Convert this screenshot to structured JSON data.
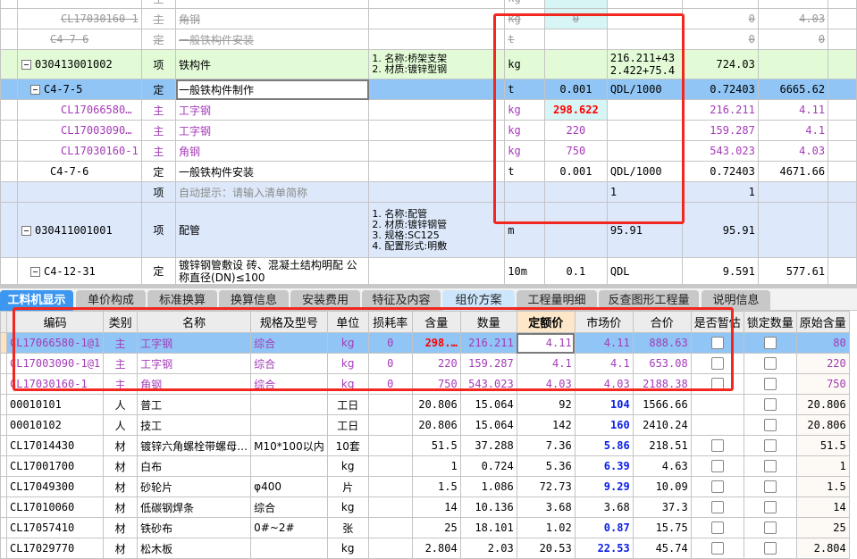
{
  "top_grid": {
    "rows": [
      {
        "style": "strike",
        "level": 2,
        "code": "",
        "type": "主",
        "name": "",
        "feature": "",
        "unit": "kg",
        "content": "",
        "expr": "",
        "qty": "",
        "price": ""
      },
      {
        "style": "strike",
        "level": 2,
        "code": "CL17030160-1",
        "type": "主",
        "name": "角钢",
        "feature": "",
        "unit": "kg",
        "content": "0",
        "expr": "",
        "qty": "0",
        "price": "4.03"
      },
      {
        "style": "strike",
        "level": 1,
        "code": "C4-7-6",
        "type": "定",
        "name": "一般铁构件安装",
        "feature": "",
        "unit": "t",
        "content": "",
        "expr": "",
        "qty": "0",
        "price": "0"
      },
      {
        "style": "green",
        "level": 0,
        "box": true,
        "code": "030413001002",
        "type": "项",
        "name": "铁构件",
        "feature": "1. 名称:桥架支架\n2. 材质:镀锌型钢",
        "unit": "kg",
        "content": "",
        "expr": "216.211+432.422+75.4",
        "qty": "724.03",
        "price": ""
      },
      {
        "style": "sel",
        "level": 1,
        "box": true,
        "code": "C4-7-5",
        "type": "定",
        "name": "一般铁构件制作",
        "feature": "",
        "unit": "t",
        "content": "0.001",
        "expr": "QDL/1000",
        "qty": "0.72403",
        "price": "6665.62"
      },
      {
        "style": "purple",
        "level": 2,
        "code": "CL17066580…",
        "type": "主",
        "name": "工字钢",
        "feature": "",
        "unit": "kg",
        "content": "298.622",
        "expr": "",
        "qty": "216.211",
        "price": "4.11"
      },
      {
        "style": "purple",
        "level": 2,
        "code": "CL17003090…",
        "type": "主",
        "name": "工字钢",
        "feature": "",
        "unit": "kg",
        "content": "220",
        "expr": "",
        "qty": "159.287",
        "price": "4.1"
      },
      {
        "style": "purple",
        "level": 2,
        "code": "CL17030160-1",
        "type": "主",
        "name": "角钢",
        "feature": "",
        "unit": "kg",
        "content": "750",
        "expr": "",
        "qty": "543.023",
        "price": "4.03"
      },
      {
        "style": "",
        "level": 1,
        "code": "C4-7-6",
        "type": "定",
        "name": "一般铁构件安装",
        "feature": "",
        "unit": "t",
        "content": "0.001",
        "expr": "QDL/1000",
        "qty": "0.72403",
        "price": "4671.66"
      },
      {
        "style": "lb",
        "level": 0,
        "code": "",
        "type": "项",
        "name": "自动提示：请输入清单简称",
        "feature": "",
        "unit": "",
        "content": "",
        "expr": "1",
        "qty": "1",
        "price": ""
      },
      {
        "style": "lb",
        "level": 0,
        "box": true,
        "code": "030411001001",
        "type": "项",
        "name": "配管",
        "feature": "1. 名称:配管\n2. 材质:镀锌钢管\n3. 规格:SC125\n4. 配置形式:明敷",
        "unit": "m",
        "content": "",
        "expr": "95.91",
        "qty": "95.91",
        "price": ""
      },
      {
        "style": "",
        "level": 1,
        "box": true,
        "code": "C4-12-31",
        "type": "定",
        "name": "镀锌钢管敷设 砖、混凝土结构明配 公称直径(DN)≤100",
        "feature": "",
        "unit": "10m",
        "content": "0.1",
        "expr": "QDL",
        "qty": "9.591",
        "price": "577.61"
      }
    ]
  },
  "tabs": [
    "工料机显示",
    "单价构成",
    "标准换算",
    "换算信息",
    "安装费用",
    "特征及内容",
    "组价方案",
    "工程量明细",
    "反查图形工程量",
    "说明信息"
  ],
  "bottom_grid": {
    "headers": [
      "编码",
      "类别",
      "名称",
      "规格及型号",
      "单位",
      "损耗率",
      "含量",
      "数量",
      "定额价",
      "市场价",
      "合价",
      "是否暂估",
      "锁定数量",
      "原始含量"
    ],
    "rows": [
      {
        "style": "sel purple",
        "code": "CL17066580-1@1",
        "type": "主",
        "name": "工字钢",
        "spec": "综合",
        "unit": "kg",
        "loss": "0",
        "content": "298.…",
        "qty": "216.211",
        "quota": "4.11",
        "market": "4.11",
        "total": "888.63",
        "est": true,
        "lock": true,
        "orig": "80"
      },
      {
        "style": "purple",
        "code": "CL17003090-1@1",
        "type": "主",
        "name": "工字钢",
        "spec": "综合",
        "unit": "kg",
        "loss": "0",
        "content": "220",
        "qty": "159.287",
        "quota": "4.1",
        "market": "4.1",
        "total": "653.08",
        "est": true,
        "lock": true,
        "orig": "220"
      },
      {
        "style": "purple",
        "code": "CL17030160-1",
        "type": "主",
        "name": "角钢",
        "spec": "综合",
        "unit": "kg",
        "loss": "0",
        "content": "750",
        "qty": "543.023",
        "quota": "4.03",
        "market": "4.03",
        "total": "2188.38",
        "est": true,
        "lock": true,
        "orig": "750"
      },
      {
        "style": "",
        "code": "00010101",
        "type": "人",
        "name": "普工",
        "spec": "",
        "unit": "工日",
        "loss": "",
        "content": "20.806",
        "qty": "15.064",
        "quota": "92",
        "market": "104",
        "mblue": true,
        "total": "1566.66",
        "est": false,
        "lock": true,
        "orig": "20.806"
      },
      {
        "style": "",
        "code": "00010102",
        "type": "人",
        "name": "技工",
        "spec": "",
        "unit": "工日",
        "loss": "",
        "content": "20.806",
        "qty": "15.064",
        "quota": "142",
        "market": "160",
        "mblue": true,
        "total": "2410.24",
        "est": false,
        "lock": true,
        "orig": "20.806"
      },
      {
        "style": "",
        "code": "CL17014430",
        "type": "材",
        "name": "镀锌六角螺栓带螺母…",
        "spec": "M10*100以内",
        "unit": "10套",
        "loss": "",
        "content": "51.5",
        "qty": "37.288",
        "quota": "7.36",
        "market": "5.86",
        "mblue": true,
        "total": "218.51",
        "est": true,
        "lock": true,
        "orig": "51.5"
      },
      {
        "style": "",
        "code": "CL17001700",
        "type": "材",
        "name": "白布",
        "spec": "",
        "unit": "kg",
        "loss": "",
        "content": "1",
        "qty": "0.724",
        "quota": "5.36",
        "market": "6.39",
        "mblue": true,
        "total": "4.63",
        "est": true,
        "lock": true,
        "orig": "1"
      },
      {
        "style": "",
        "code": "CL17049300",
        "type": "材",
        "name": "砂轮片",
        "spec": "φ400",
        "unit": "片",
        "loss": "",
        "content": "1.5",
        "qty": "1.086",
        "quota": "72.73",
        "market": "9.29",
        "mblue": true,
        "total": "10.09",
        "est": true,
        "lock": true,
        "orig": "1.5"
      },
      {
        "style": "",
        "code": "CL17010060",
        "type": "材",
        "name": "低碳钢焊条",
        "spec": "综合",
        "unit": "kg",
        "loss": "",
        "content": "14",
        "qty": "10.136",
        "quota": "3.68",
        "market": "3.68",
        "total": "37.3",
        "est": true,
        "lock": true,
        "orig": "14"
      },
      {
        "style": "",
        "code": "CL17057410",
        "type": "材",
        "name": "铁砂布",
        "spec": "0#~2#",
        "unit": "张",
        "loss": "",
        "content": "25",
        "qty": "18.101",
        "quota": "1.02",
        "market": "0.87",
        "mblue": true,
        "total": "15.75",
        "est": true,
        "lock": true,
        "orig": "25"
      },
      {
        "style": "",
        "code": "CL17029770",
        "type": "材",
        "name": "松木板",
        "spec": "",
        "unit": "kg",
        "loss": "",
        "content": "2.804",
        "qty": "2.03",
        "quota": "20.53",
        "market": "22.53",
        "mblue": true,
        "total": "45.74",
        "est": true,
        "lock": true,
        "orig": "2.804"
      }
    ]
  },
  "colors": {
    "accent": "#3d97f0",
    "selected_row": "#90c5f5",
    "highlight_box": "#f2271f"
  }
}
